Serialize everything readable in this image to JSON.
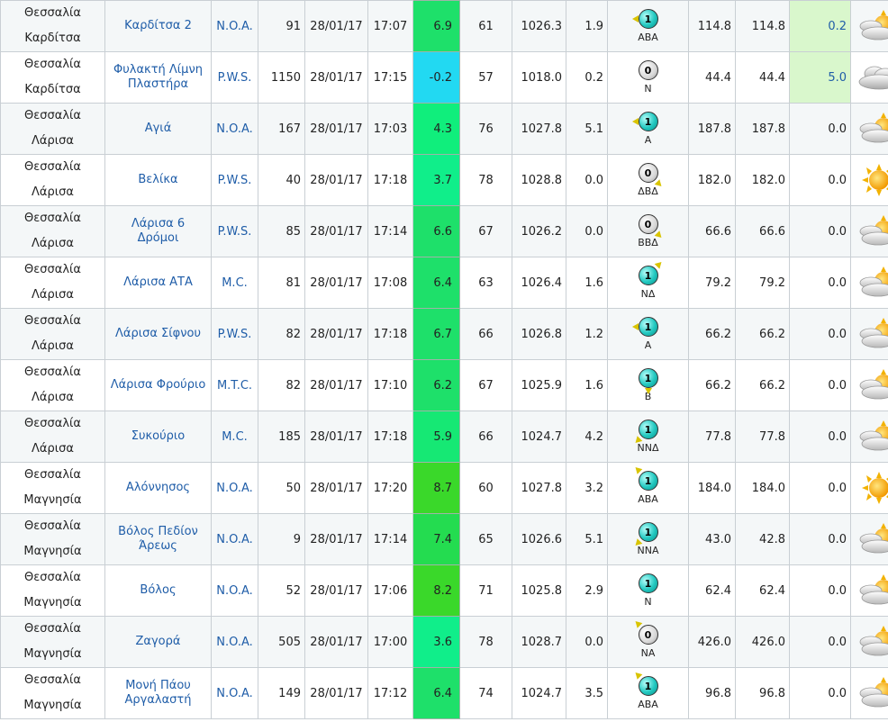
{
  "colors": {
    "station_link": "#1f5da8",
    "temp_gradient": [
      "#00e5e0",
      "#00f08c",
      "#1ee06a",
      "#00e34a",
      "#2ed82e",
      "#5ad41e"
    ],
    "rain_highlight": "#d9f7cc"
  },
  "rows": [
    {
      "region": "Θεσσαλία",
      "prefecture": "Καρδίτσα",
      "station": "Καρδίτσα 2",
      "network": "N.O.A.",
      "altitude": "91",
      "date": "28/01/17",
      "time": "17:07",
      "temp": "6.9",
      "temp_color": "#1ee06a",
      "humidity": "61",
      "pressure": "1026.3",
      "wind_speed": "1.9",
      "wind_force": "1",
      "wind_color": "teal",
      "wind_arrow": "left",
      "wind_dir": "ΑΒΑ",
      "max1": "114.8",
      "max2": "114.8",
      "rain": "0.2",
      "rain_hl": true,
      "weather_icon": "partly-sunny-icon"
    },
    {
      "region": "Θεσσαλία",
      "prefecture": "Καρδίτσα",
      "station": "Φυλακτή Λίμνη Πλαστήρα",
      "network": "P.W.S.",
      "altitude": "1150",
      "date": "28/01/17",
      "time": "17:15",
      "temp": "-0.2",
      "temp_color": "#22d9f2",
      "humidity": "57",
      "pressure": "1018.0",
      "wind_speed": "0.2",
      "wind_force": "0",
      "wind_color": "grey",
      "wind_arrow": "",
      "wind_dir": "Ν",
      "max1": "44.4",
      "max2": "44.4",
      "rain": "5.0",
      "rain_hl": true,
      "weather_icon": "cloudy-icon"
    },
    {
      "region": "Θεσσαλία",
      "prefecture": "Λάρισα",
      "station": "Αγιά",
      "network": "N.O.A.",
      "altitude": "167",
      "date": "28/01/17",
      "time": "17:03",
      "temp": "4.3",
      "temp_color": "#10ee7c",
      "humidity": "76",
      "pressure": "1027.8",
      "wind_speed": "5.1",
      "wind_force": "1",
      "wind_color": "teal",
      "wind_arrow": "left",
      "wind_dir": "Α",
      "max1": "187.8",
      "max2": "187.8",
      "rain": "0.0",
      "rain_hl": false,
      "weather_icon": "partly-sunny-icon"
    },
    {
      "region": "Θεσσαλία",
      "prefecture": "Λάρισα",
      "station": "Βελίκα",
      "network": "P.W.S.",
      "altitude": "40",
      "date": "28/01/17",
      "time": "17:18",
      "temp": "3.7",
      "temp_color": "#10ee8a",
      "humidity": "78",
      "pressure": "1028.8",
      "wind_speed": "0.0",
      "wind_force": "0",
      "wind_color": "grey",
      "wind_arrow": "downright",
      "wind_dir": "ΔΒΔ",
      "max1": "182.0",
      "max2": "182.0",
      "rain": "0.0",
      "rain_hl": false,
      "weather_icon": "sunny-icon"
    },
    {
      "region": "Θεσσαλία",
      "prefecture": "Λάρισα",
      "station": "Λάρισα 6 Δρόμοι",
      "network": "P.W.S.",
      "altitude": "85",
      "date": "28/01/17",
      "time": "17:14",
      "temp": "6.6",
      "temp_color": "#1ee06a",
      "humidity": "67",
      "pressure": "1026.2",
      "wind_speed": "0.0",
      "wind_force": "0",
      "wind_color": "grey",
      "wind_arrow": "downright",
      "wind_dir": "ΒΒΔ",
      "max1": "66.6",
      "max2": "66.6",
      "rain": "0.0",
      "rain_hl": false,
      "weather_icon": "partly-sunny-icon"
    },
    {
      "region": "Θεσσαλία",
      "prefecture": "Λάρισα",
      "station": "Λάρισα ΑΤΑ",
      "network": "M.C.",
      "altitude": "81",
      "date": "28/01/17",
      "time": "17:08",
      "temp": "6.4",
      "temp_color": "#1ee06a",
      "humidity": "63",
      "pressure": "1026.4",
      "wind_speed": "1.6",
      "wind_force": "1",
      "wind_color": "teal",
      "wind_arrow": "upright",
      "wind_dir": "ΝΔ",
      "max1": "79.2",
      "max2": "79.2",
      "rain": "0.0",
      "rain_hl": false,
      "weather_icon": "partly-sunny-icon"
    },
    {
      "region": "Θεσσαλία",
      "prefecture": "Λάρισα",
      "station": "Λάρισα Σίφνου",
      "network": "P.W.S.",
      "altitude": "82",
      "date": "28/01/17",
      "time": "17:18",
      "temp": "6.7",
      "temp_color": "#1ee06a",
      "humidity": "66",
      "pressure": "1026.8",
      "wind_speed": "1.2",
      "wind_force": "1",
      "wind_color": "teal",
      "wind_arrow": "left",
      "wind_dir": "Α",
      "max1": "66.2",
      "max2": "66.2",
      "rain": "0.0",
      "rain_hl": false,
      "weather_icon": "partly-sunny-icon"
    },
    {
      "region": "Θεσσαλία",
      "prefecture": "Λάρισα",
      "station": "Λάρισα Φρούριο",
      "network": "M.T.C.",
      "altitude": "82",
      "date": "28/01/17",
      "time": "17:10",
      "temp": "6.2",
      "temp_color": "#1ee06a",
      "humidity": "67",
      "pressure": "1025.9",
      "wind_speed": "1.6",
      "wind_force": "1",
      "wind_color": "teal",
      "wind_arrow": "down",
      "wind_dir": "Β",
      "max1": "66.2",
      "max2": "66.2",
      "rain": "0.0",
      "rain_hl": false,
      "weather_icon": "partly-sunny-icon"
    },
    {
      "region": "Θεσσαλία",
      "prefecture": "Λάρισα",
      "station": "Συκούριο",
      "network": "M.C.",
      "altitude": "185",
      "date": "28/01/17",
      "time": "17:18",
      "temp": "5.9",
      "temp_color": "#16e874",
      "humidity": "66",
      "pressure": "1024.7",
      "wind_speed": "4.2",
      "wind_force": "1",
      "wind_color": "teal",
      "wind_arrow": "downleft",
      "wind_dir": "ΝΝΔ",
      "max1": "77.8",
      "max2": "77.8",
      "rain": "0.0",
      "rain_hl": false,
      "weather_icon": "partly-sunny-icon"
    },
    {
      "region": "Θεσσαλία",
      "prefecture": "Μαγνησία",
      "station": "Αλόννησος",
      "network": "N.O.A.",
      "altitude": "50",
      "date": "28/01/17",
      "time": "17:20",
      "temp": "8.7",
      "temp_color": "#3ad82a",
      "humidity": "60",
      "pressure": "1027.8",
      "wind_speed": "3.2",
      "wind_force": "1",
      "wind_color": "teal",
      "wind_arrow": "upleft",
      "wind_dir": "ΑΒΑ",
      "max1": "184.0",
      "max2": "184.0",
      "rain": "0.0",
      "rain_hl": false,
      "weather_icon": "sunny-icon"
    },
    {
      "region": "Θεσσαλία",
      "prefecture": "Μαγνησία",
      "station": "Βόλος Πεδίον Άρεως",
      "network": "N.O.A.",
      "altitude": "9",
      "date": "28/01/17",
      "time": "17:14",
      "temp": "7.4",
      "temp_color": "#24dc50",
      "humidity": "65",
      "pressure": "1026.6",
      "wind_speed": "5.1",
      "wind_force": "1",
      "wind_color": "teal",
      "wind_arrow": "downleft",
      "wind_dir": "ΝΝΑ",
      "max1": "43.0",
      "max2": "42.8",
      "rain": "0.0",
      "rain_hl": false,
      "weather_icon": "partly-sunny-icon"
    },
    {
      "region": "Θεσσαλία",
      "prefecture": "Μαγνησία",
      "station": "Βόλος",
      "network": "N.O.A.",
      "altitude": "52",
      "date": "28/01/17",
      "time": "17:06",
      "temp": "8.2",
      "temp_color": "#3ad82a",
      "humidity": "71",
      "pressure": "1025.8",
      "wind_speed": "2.9",
      "wind_force": "1",
      "wind_color": "teal",
      "wind_arrow": "",
      "wind_dir": "Ν",
      "max1": "62.4",
      "max2": "62.4",
      "rain": "0.0",
      "rain_hl": false,
      "weather_icon": "partly-sunny-icon"
    },
    {
      "region": "Θεσσαλία",
      "prefecture": "Μαγνησία",
      "station": "Ζαγορά",
      "network": "N.O.A.",
      "altitude": "505",
      "date": "28/01/17",
      "time": "17:00",
      "temp": "3.6",
      "temp_color": "#10ee8a",
      "humidity": "78",
      "pressure": "1028.7",
      "wind_speed": "0.0",
      "wind_force": "0",
      "wind_color": "grey",
      "wind_arrow": "upleft",
      "wind_dir": "ΝΑ",
      "max1": "426.0",
      "max2": "426.0",
      "rain": "0.0",
      "rain_hl": false,
      "weather_icon": "partly-sunny-icon"
    },
    {
      "region": "Θεσσαλία",
      "prefecture": "Μαγνησία",
      "station": "Μονή Πάου Αργαλαστή",
      "network": "N.O.A.",
      "altitude": "149",
      "date": "28/01/17",
      "time": "17:12",
      "temp": "6.4",
      "temp_color": "#1ee06a",
      "humidity": "74",
      "pressure": "1024.7",
      "wind_speed": "3.5",
      "wind_force": "1",
      "wind_color": "teal",
      "wind_arrow": "upleft",
      "wind_dir": "ΑΒΑ",
      "max1": "96.8",
      "max2": "96.8",
      "rain": "0.0",
      "rain_hl": false,
      "weather_icon": "partly-sunny-icon"
    }
  ]
}
